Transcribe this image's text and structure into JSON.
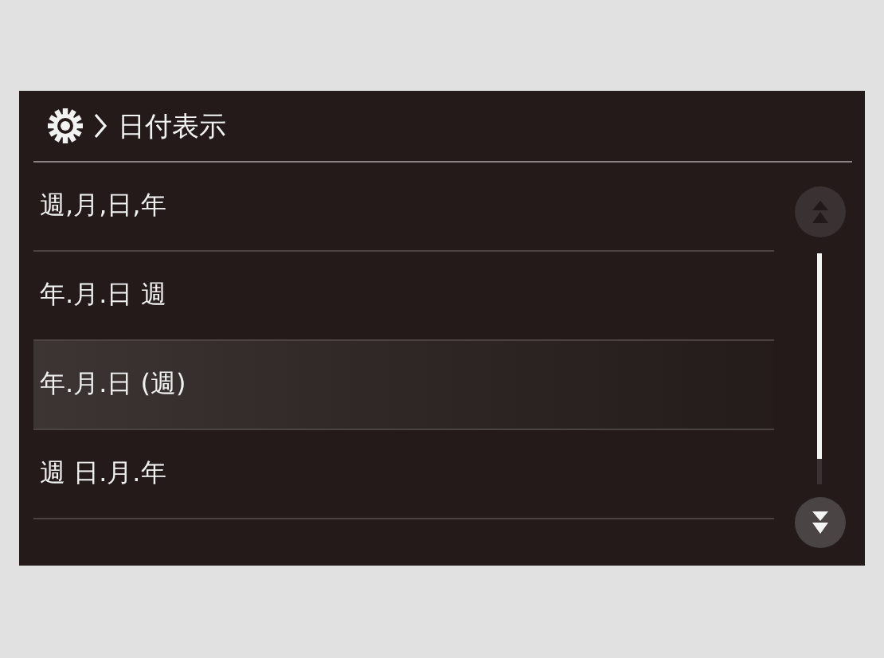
{
  "header": {
    "title": "日付表示"
  },
  "options": [
    {
      "label": "週,月,日,年",
      "selected": false
    },
    {
      "label": "年.月.日 週",
      "selected": false
    },
    {
      "label": "年.月.日 (週)",
      "selected": true
    },
    {
      "label": "週 日.月.年",
      "selected": false
    }
  ],
  "scroll_buttons": [
    {
      "kind": "up",
      "disabled": true
    },
    {
      "kind": "down",
      "disabled": false
    }
  ]
}
